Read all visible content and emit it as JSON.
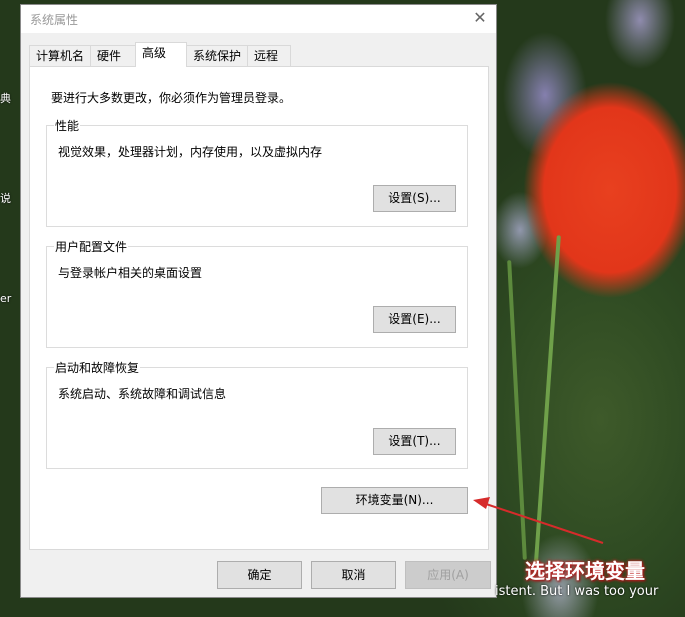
{
  "dialog": {
    "title": "系统属性",
    "tabs": [
      {
        "label": "计算机名"
      },
      {
        "label": "硬件"
      },
      {
        "label": "高级"
      },
      {
        "label": "系统保护"
      },
      {
        "label": "远程"
      }
    ],
    "active_tab": "高级",
    "notice": "要进行大多数更改，你必须作为管理员登录。",
    "groups": {
      "performance": {
        "title": "性能",
        "desc": "视觉效果，处理器计划，内存使用，以及虚拟内存",
        "button": "设置(S)..."
      },
      "user_profiles": {
        "title": "用户配置文件",
        "desc": "与登录帐户相关的桌面设置",
        "button": "设置(E)..."
      },
      "startup_recovery": {
        "title": "启动和故障恢复",
        "desc": "系统启动、系统故障和调试信息",
        "button": "设置(T)..."
      }
    },
    "env_button": "环境变量(N)...",
    "footer": {
      "ok": "确定",
      "cancel": "取消",
      "apply": "应用(A)"
    }
  },
  "annotation": {
    "label": "选择环境变量",
    "color": "#d62b2b"
  },
  "desktop": {
    "edge_text": [
      "典",
      "说",
      "er"
    ],
    "bottom_text": "istent. But I was too your"
  }
}
